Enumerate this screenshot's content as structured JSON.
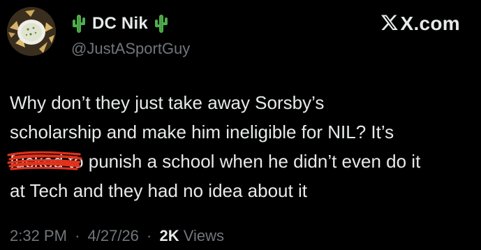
{
  "post": {
    "author": {
      "display_name": "DC Nik",
      "name_emoji": "cactus-icon",
      "handle": "@JustASportGuy",
      "avatar": "avatar-photo"
    },
    "brand_label": "X.com",
    "body_lines": [
      "Why don’t they just take away Sorsby’s",
      "scholarship and make him ineligible for NIL? It’s",
      "to punish a school when he didn’t even do it",
      "at Tech and they had no idea about it"
    ],
    "redacted_word": "fucked",
    "redaction_color": "#e0321c",
    "time": "2:32 PM",
    "date": "4/27/26",
    "separator": "·",
    "views_count": "2K",
    "views_label": "Views"
  },
  "colors": {
    "background": "#000000",
    "primary_text": "#e7e9ea",
    "secondary_text": "#71767b"
  }
}
